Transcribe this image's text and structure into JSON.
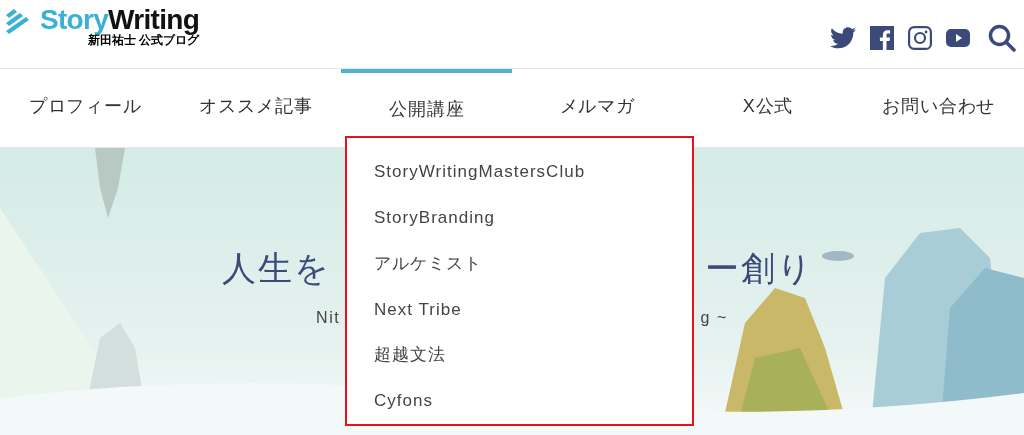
{
  "header": {
    "logo": {
      "brand_left": "Story",
      "brand_right": "Writing",
      "tagline": "新田祐士 公式ブログ"
    }
  },
  "nav": [
    {
      "label": "プロフィール",
      "selected": false
    },
    {
      "label": "オススメ記事",
      "selected": false
    },
    {
      "label": "公開講座",
      "selected": true
    },
    {
      "label": "メルマガ",
      "selected": false
    },
    {
      "label": "X公式",
      "selected": false
    },
    {
      "label": "お問い合わせ",
      "selected": false
    }
  ],
  "hero": {
    "title_left": "人生を",
    "title_right": "ー創り",
    "subtitle_left": "Nit",
    "subtitle_right": "g ~"
  },
  "dropdown": {
    "highlighted": true,
    "items": [
      {
        "label": "StoryWritingMastersClub"
      },
      {
        "label": "StoryBranding"
      },
      {
        "label": "アルケミスト"
      },
      {
        "label": "Next Tribe"
      },
      {
        "label": "超越文法"
      },
      {
        "label": "Cyfons"
      }
    ]
  }
}
